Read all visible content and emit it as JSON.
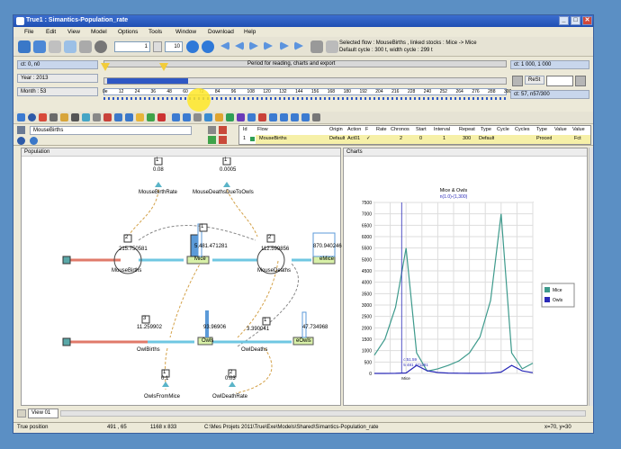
{
  "window": {
    "title": "True1 : Simantics-Population_rate",
    "controls": [
      "_",
      "□",
      "✕"
    ]
  },
  "menu": [
    "File",
    "Edit",
    "View",
    "Model",
    "Options",
    "Tools",
    "Window",
    "Download",
    "Help"
  ],
  "toolbar": {
    "step_value": "1",
    "speed_value": "10",
    "flow_info_line1": "Selected flow : MouseBirths , linked stocks : Mice -> Mice",
    "flow_info_line2": "Default cycle : 300 t, width cycle : 299 t"
  },
  "timeline": {
    "left_top": "ct: 0, n0",
    "year": "Year : 2013",
    "month": "Month : 53",
    "period_label": "Period for reading, charts and export",
    "right_top": "ct: 1 000, 1 000",
    "reset_label": "ReSt",
    "right_bottom": "ct: 57, n57/300",
    "ticks": [
      "0e",
      "12",
      "24",
      "36",
      "48",
      "60",
      "72",
      "84",
      "96",
      "108",
      "120",
      "132",
      "144",
      "156",
      "168",
      "180",
      "192",
      "204",
      "216",
      "228",
      "240",
      "252",
      "264",
      "276",
      "288",
      "300"
    ]
  },
  "param": {
    "name": "MouseBirths"
  },
  "flow_table": {
    "headers": [
      "Id",
      "Flow",
      "Origin",
      "Action",
      "F",
      "Rate",
      "Chronos",
      "Start",
      "Interval",
      "Repeat",
      "Type",
      "Cycle",
      "Cycles",
      "Type",
      "Value",
      "Value"
    ],
    "row": [
      "1",
      "MouseBirths",
      "Default",
      "Act01",
      "✓",
      "",
      "2",
      "0",
      "1",
      "300",
      "Default",
      "",
      "",
      "Proced",
      "",
      "Fct"
    ]
  },
  "population_panel": {
    "title": "Population",
    "nodes": {
      "mouse_birth_rate_value": "0.08",
      "mouse_birth_rate_label": "MouseBirthRate",
      "mouse_death_rate_value": "0.0005",
      "mouse_death_rate_label": "MouseDeathsDueToOwls",
      "mouse_births_value": "215.750581",
      "mouse_births_label": "MouseBirths",
      "mice_value": "5,481.471281",
      "mice_label": "Mice",
      "mouse_deaths_value": "112.599856",
      "mouse_deaths_label": "MouseDeaths",
      "emice_value": "870.940246",
      "emice_label": "eMice",
      "owl_births_value": "11.259902",
      "owl_births_label": "OwlBirths",
      "owls_value": "93.96906",
      "owls_label": "Owls",
      "owl_deaths_value": "3.390041",
      "owl_deaths_label": "OwlDeaths",
      "eowls_value": "47.734968",
      "eowls_label": "eOwls",
      "owls_from_mice_value": "0.1",
      "owls_from_mice_label": "OwlsFromMice",
      "owl_death_rate_value": "0.03",
      "owl_death_rate_label": "OwlDeathRate",
      "badge_1": "1",
      "badge_2": "1",
      "badge_3": "2",
      "badge_4": "1",
      "badge_5": "2",
      "badge_6": "3",
      "badge_7": "1",
      "badge_8": "1",
      "badge_9": "2"
    }
  },
  "charts_panel": {
    "title": "Charts"
  },
  "chart_data": {
    "type": "line",
    "title": "Mice & Owls",
    "subtitle": "n(1.0)-(1,300)",
    "x": [
      0,
      20,
      40,
      60,
      80,
      100,
      120,
      140,
      160,
      180,
      200,
      220,
      240,
      260,
      280,
      300
    ],
    "ylim": [
      0,
      7500
    ],
    "yticks": [
      "0",
      "500",
      "1000",
      "1500",
      "2000",
      "2500",
      "3000",
      "3500",
      "4000",
      "4500",
      "5000",
      "5500",
      "6000",
      "6500",
      "7000",
      "7500"
    ],
    "series": [
      {
        "name": "Mice",
        "color": "#3d9a8c",
        "values": [
          800,
          1500,
          2900,
          5500,
          900,
          100,
          200,
          350,
          550,
          900,
          1600,
          3200,
          7000,
          900,
          200,
          450
        ]
      },
      {
        "name": "Owls",
        "color": "#2a2ab8",
        "values": [
          0,
          0,
          5,
          20,
          350,
          120,
          40,
          15,
          8,
          5,
          5,
          10,
          60,
          350,
          110,
          30
        ]
      }
    ],
    "cursor_label_1": "c:51.59",
    "cursor_label_2": "5 481 471281",
    "cursor_label_3": "Mice",
    "legend_position": "right"
  },
  "bottom": {
    "tab_label": "View 01",
    "status_position": "True position",
    "status_coords": "491 , 65",
    "status_size": "1168 x 833",
    "status_path": "C:\\Mes Projets 2011\\True\\Exe\\Models\\Shared\\Simantics-Population_rate",
    "status_zoom": "x=70, y=30"
  }
}
